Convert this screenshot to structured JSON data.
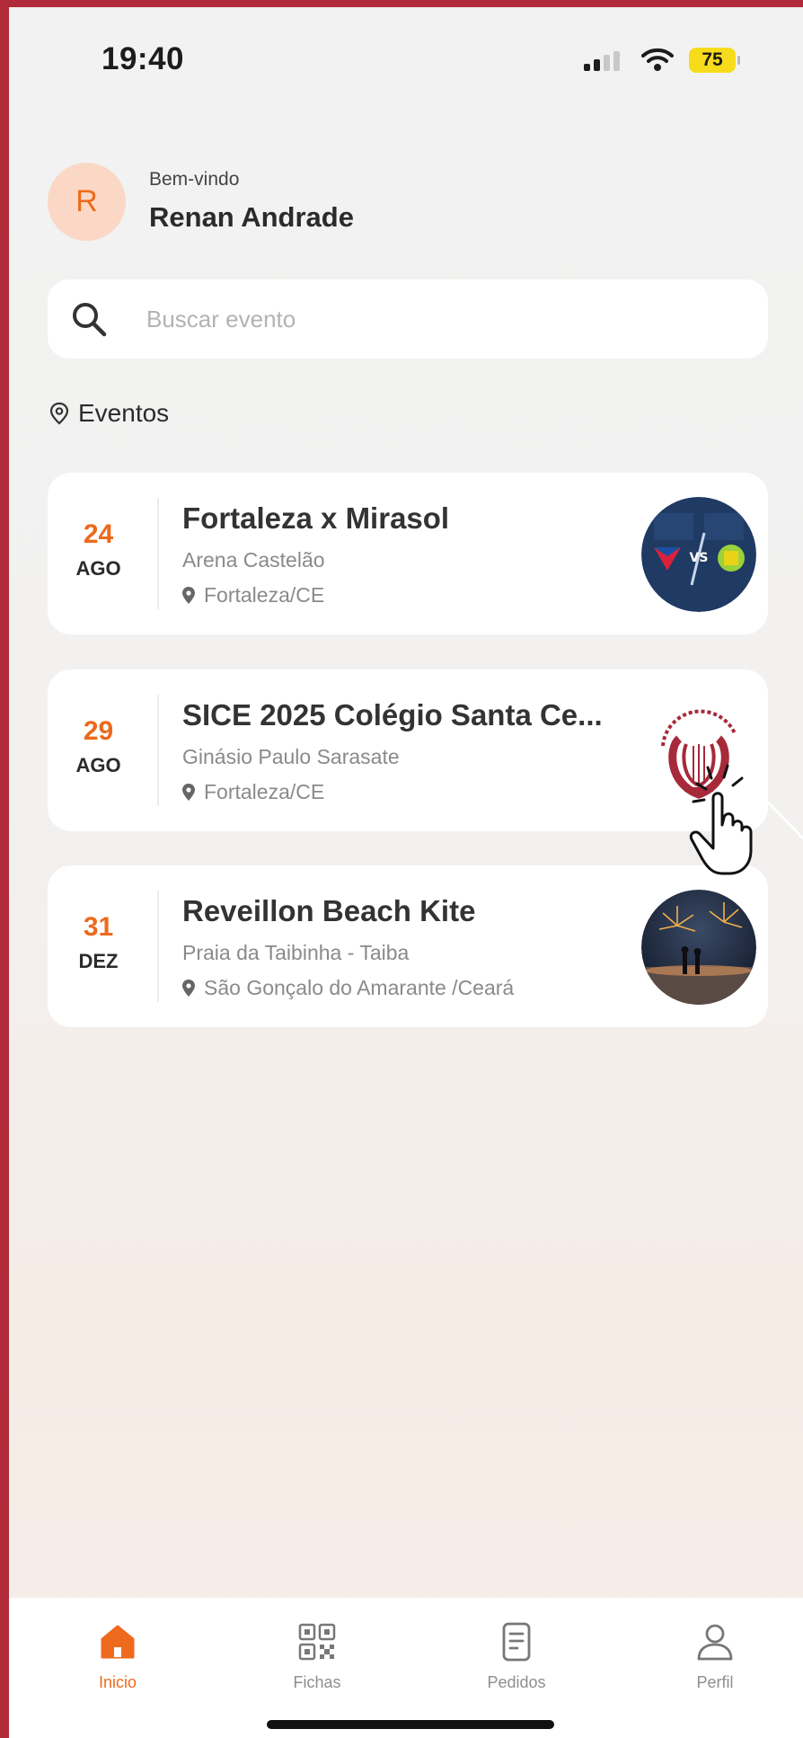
{
  "status_bar": {
    "time": "19:40",
    "battery": "75"
  },
  "greeting": {
    "avatar_initial": "R",
    "welcome": "Bem-vindo",
    "name": "Renan Andrade"
  },
  "search": {
    "placeholder": "Buscar evento"
  },
  "section": {
    "title": "Eventos",
    "icon": "location-pin-icon"
  },
  "events": [
    {
      "day": "24",
      "month": "AGO",
      "title": "Fortaleza x Mirasol",
      "venue": "Arena Castelão",
      "city": "Fortaleza/CE",
      "thumb": "match-logo"
    },
    {
      "day": "29",
      "month": "AGO",
      "title": "SICE 2025 Colégio Santa Ce...",
      "venue": "Ginásio Paulo Sarasate",
      "city": "Fortaleza/CE",
      "thumb": "school-crest"
    },
    {
      "day": "31",
      "month": "DEZ",
      "title": "Reveillon Beach Kite",
      "venue": "Praia da Taibinha - Taiba",
      "city": "São Gonçalo do Amarante  /Ceará",
      "thumb": "fireworks-photo"
    }
  ],
  "nav": [
    {
      "label": "Inicio",
      "icon": "home-icon",
      "active": true
    },
    {
      "label": "Fichas",
      "icon": "qr-code-icon",
      "active": false
    },
    {
      "label": "Pedidos",
      "icon": "document-icon",
      "active": false
    },
    {
      "label": "Perfil",
      "icon": "user-icon",
      "active": false
    }
  ],
  "colors": {
    "accent": "#ee6a1d",
    "avatar_bg": "#fbd8c6",
    "frame": "#b12a3a",
    "battery": "#f6dc1b"
  }
}
